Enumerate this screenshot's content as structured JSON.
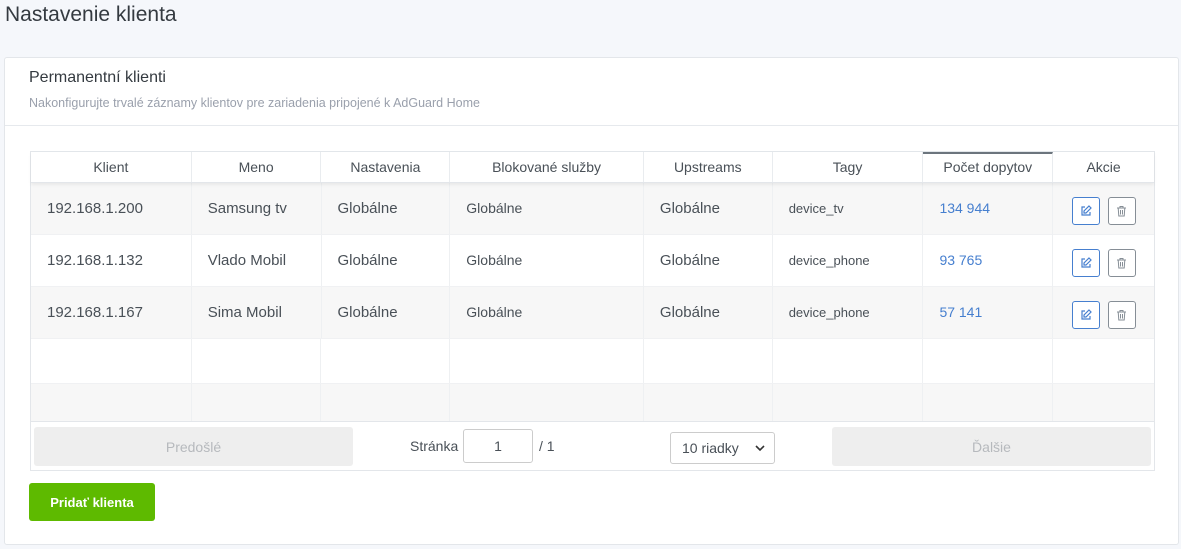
{
  "page": {
    "title": "Nastavenie klienta"
  },
  "card": {
    "title": "Permanentní klienti",
    "subtitle": "Nakonfigurujte trvalé záznamy klientov pre zariadenia pripojené k AdGuard Home"
  },
  "table": {
    "headers": [
      "Klient",
      "Meno",
      "Nastavenia",
      "Blokované služby",
      "Upstreams",
      "Tagy",
      "Počet dopytov",
      "Akcie"
    ],
    "sorted_column": "Počet dopytov",
    "rows": [
      {
        "client": "192.168.1.200",
        "name": "Samsung tv",
        "settings": "Globálne",
        "blocked": "Globálne",
        "upstreams": "Globálne",
        "tags": "device_tv",
        "queries": "134 944"
      },
      {
        "client": "192.168.1.132",
        "name": "Vlado Mobil",
        "settings": "Globálne",
        "blocked": "Globálne",
        "upstreams": "Globálne",
        "tags": "device_phone",
        "queries": "93 765"
      },
      {
        "client": "192.168.1.167",
        "name": "Sima Mobil",
        "settings": "Globálne",
        "blocked": "Globálne",
        "upstreams": "Globálne",
        "tags": "device_phone",
        "queries": "57 141"
      }
    ],
    "action_icons": [
      "edit-icon",
      "trash-icon"
    ]
  },
  "pagination": {
    "prev_label": "Predošlé",
    "next_label": "Ďalšie",
    "page_label": "Stránka",
    "page_value": "1",
    "total": "/ 1",
    "rows_option": "10 riadky"
  },
  "add_button": "Pridať klienta",
  "colors": {
    "accent": "#467fcf",
    "success": "#5eba00"
  }
}
